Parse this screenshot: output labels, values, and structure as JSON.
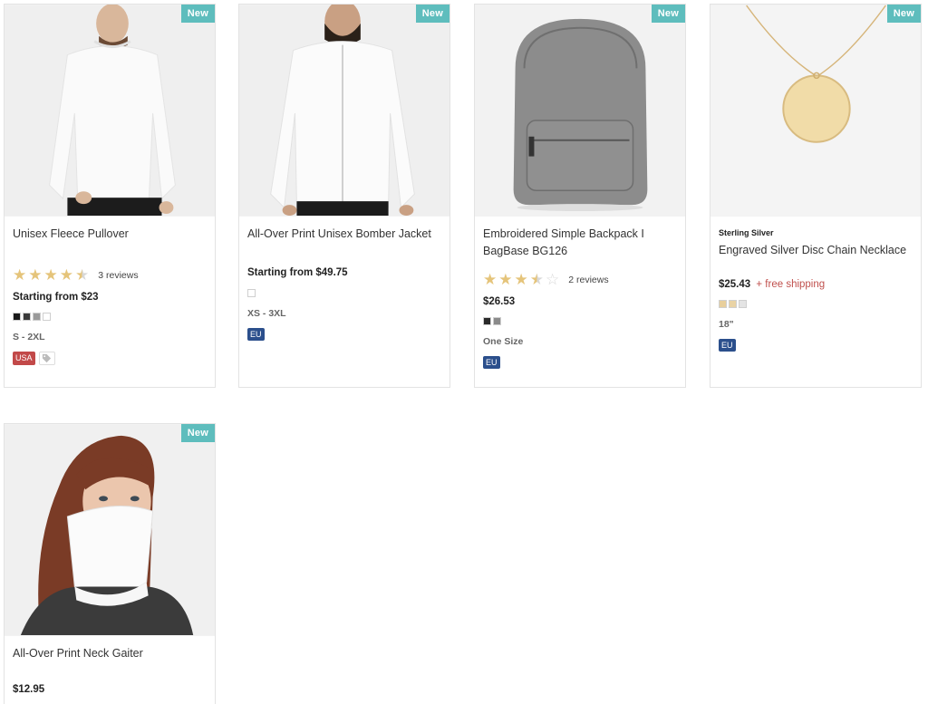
{
  "products": [
    {
      "badge": "New",
      "title": "Unisex Fleece Pullover",
      "rating": 4.5,
      "reviews": "3 reviews",
      "price": "Starting from $23",
      "swatches": [
        "#1a1a1a",
        "#3a3a3a",
        "#9a9a9a",
        "#ffffff"
      ],
      "size": "S - 2XL",
      "region": "USA",
      "tag_icon": "tag-icon"
    },
    {
      "badge": "New",
      "title": "All-Over Print Unisex Bomber Jacket",
      "price": "Starting from $49.75",
      "swatches": [
        "#ffffff"
      ],
      "size": "XS - 3XL",
      "region": "EU"
    },
    {
      "badge": "New",
      "title": "Embroidered Simple Backpack I BagBase BG126",
      "rating": 3.5,
      "reviews": "2 reviews",
      "price": "$26.53",
      "swatches": [
        "#2a2a2a",
        "#8a8a8a"
      ],
      "size": "One Size",
      "region": "EU"
    },
    {
      "badge": "New",
      "brand": "Sterling Silver",
      "title": "Engraved Silver Disc Chain Necklace",
      "price": "$25.43",
      "shipping": "+ free shipping",
      "swatches": [
        "#e8cf9c",
        "#e9d3a5",
        "#e4e4e4"
      ],
      "size": "18\"",
      "region": "EU"
    },
    {
      "badge": "New",
      "title": "All-Over Print Neck Gaiter",
      "price": "$12.95"
    }
  ],
  "colors": {
    "badge": "#5ebdbd",
    "star": "#e5c47a",
    "shipping": "#c0504d",
    "usa_tag": "#c24949",
    "eu_tag": "#2b4f8c"
  }
}
